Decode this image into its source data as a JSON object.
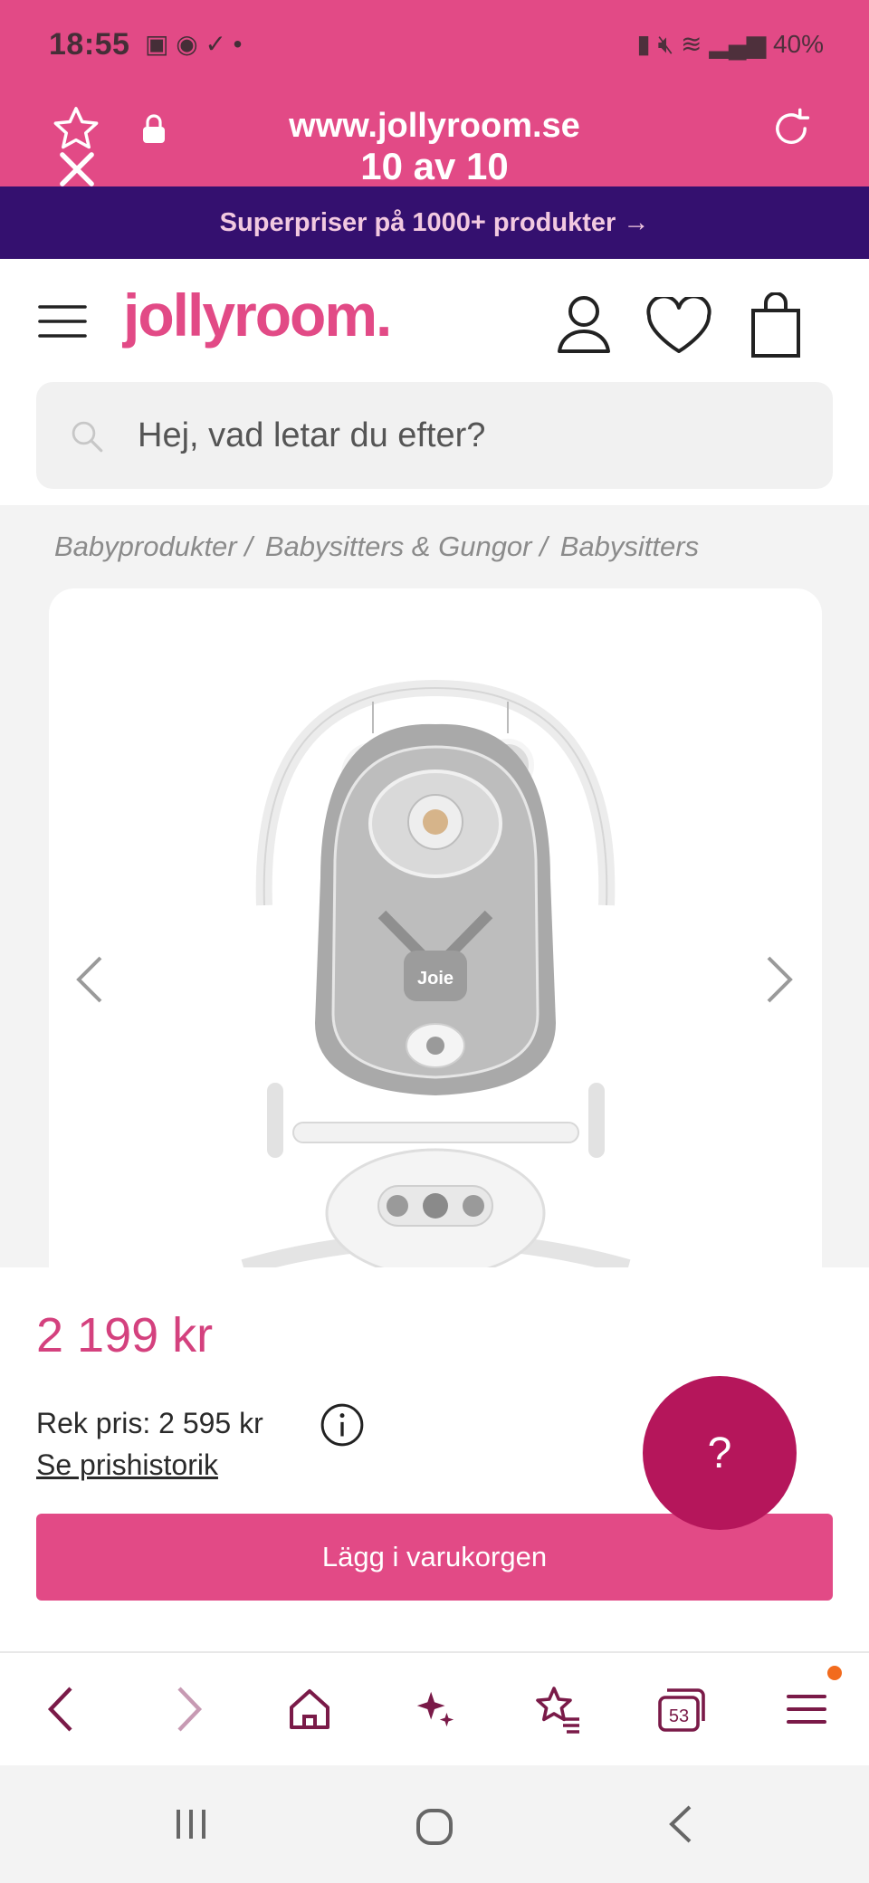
{
  "status_bar": {
    "time": "18:55",
    "battery": "40%"
  },
  "browser": {
    "url": "www.jollyroom.se",
    "counter": "10 av 10"
  },
  "promo": {
    "text": "Superpriser på 1000+ produkter →"
  },
  "header": {
    "logo": "jollyroom."
  },
  "search": {
    "placeholder": "Hej, vad letar du efter?"
  },
  "breadcrumb": {
    "items": [
      "Babyprodukter /",
      "Babysitters & Gungor /",
      "Babysitters"
    ]
  },
  "product": {
    "brand_on_image": "Joie",
    "price": "2 199 kr",
    "rek_price": "Rek pris: 2 595 kr",
    "history_link": "Se prishistorik",
    "help_label": "?",
    "add_to_cart": "Lägg i varukorgen"
  },
  "bottom_bar": {
    "tabs_count": "53"
  },
  "colors": {
    "brand_pink": "#e24a86",
    "promo_purple": "#34106f",
    "help_magenta": "#b5165b",
    "nav_icon": "#7a1a48"
  }
}
